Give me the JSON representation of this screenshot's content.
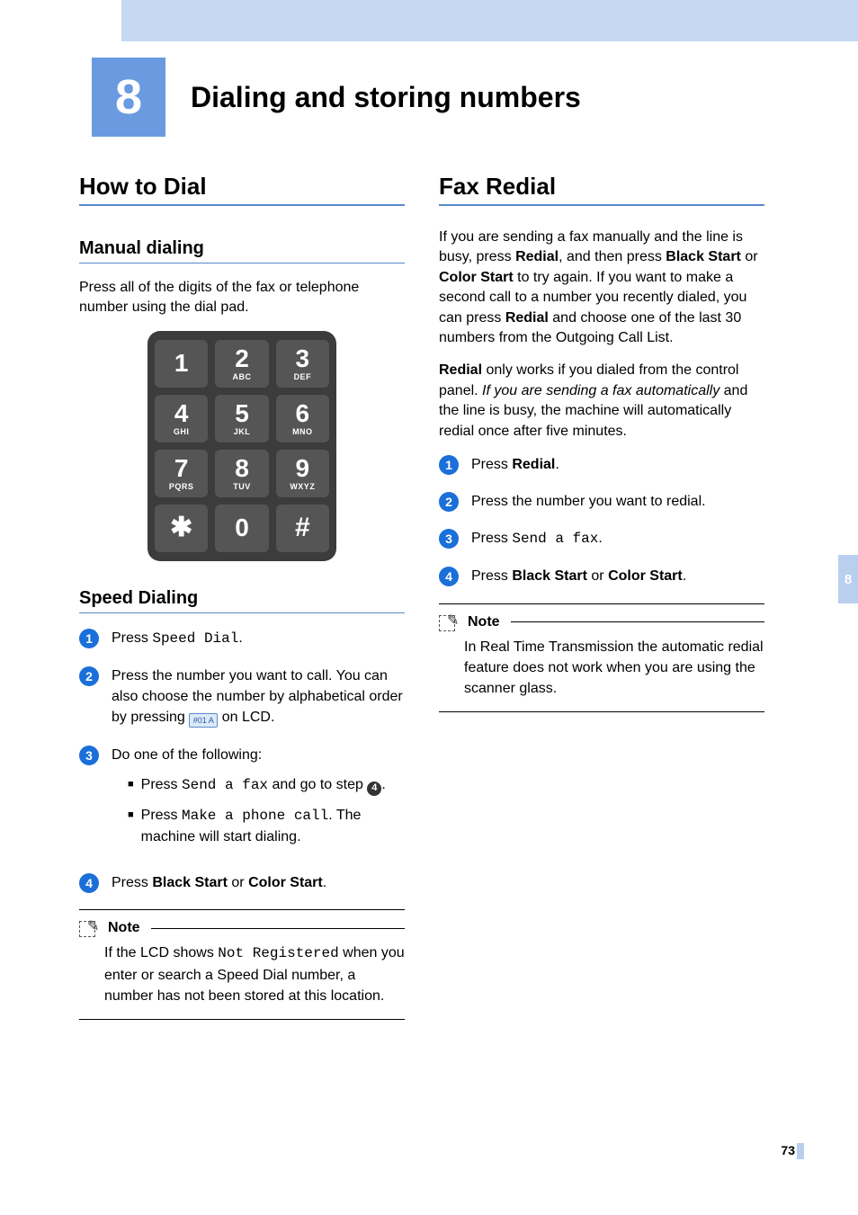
{
  "chapter": {
    "number": "8",
    "title": "Dialing and storing numbers"
  },
  "sideTab": "8",
  "pageNumber": "73",
  "left": {
    "h1": "How to Dial",
    "manual": {
      "heading": "Manual dialing",
      "text": "Press all of the digits of the fax or telephone number using the dial pad."
    },
    "dialpad": [
      {
        "n": "1",
        "l": ""
      },
      {
        "n": "2",
        "l": "ABC"
      },
      {
        "n": "3",
        "l": "DEF"
      },
      {
        "n": "4",
        "l": "GHI"
      },
      {
        "n": "5",
        "l": "JKL"
      },
      {
        "n": "6",
        "l": "MNO"
      },
      {
        "n": "7",
        "l": "PQRS"
      },
      {
        "n": "8",
        "l": "TUV"
      },
      {
        "n": "9",
        "l": "WXYZ"
      },
      {
        "n": "✱",
        "l": ""
      },
      {
        "n": "0",
        "l": ""
      },
      {
        "n": "#",
        "l": ""
      }
    ],
    "speed": {
      "heading": "Speed Dialing",
      "s1_a": "Press ",
      "s1_code": "Speed Dial",
      "s1_b": ".",
      "s2_a": "Press the number you want to call. You can also choose the number by alphabetical order by pressing ",
      "s2_b": " on LCD.",
      "s3": "Do one of the following:",
      "s3_b1_a": "Press ",
      "s3_b1_code": "Send a fax",
      "s3_b1_b": " and go to step ",
      "s3_b1_badge": "4",
      "s3_b1_c": ".",
      "s3_b2_a": "Press ",
      "s3_b2_code": "Make a phone call",
      "s3_b2_b": ". The machine will start dialing.",
      "s4_a": "Press ",
      "s4_b1": "Black Start",
      "s4_or": " or ",
      "s4_b2": "Color Start",
      "s4_c": ".",
      "note": {
        "label": "Note",
        "text_a": "If the LCD shows ",
        "text_code": "Not Registered",
        "text_b": " when you enter or search a Speed Dial number, a number has not been stored at this location."
      }
    }
  },
  "right": {
    "h1": "Fax Redial",
    "p1_a": "If you are sending a fax manually and the line is busy, press ",
    "p1_b": "Redial",
    "p1_c": ", and then press ",
    "p1_d": "Black Start",
    "p1_e": " or ",
    "p1_f": "Color Start",
    "p1_g": " to try again. If you want to make a second call to a number you recently dialed, you can press ",
    "p1_h": "Redial",
    "p1_i": " and choose one of the last 30 numbers from the Outgoing Call List.",
    "p2_a": "Redial",
    "p2_b": " only works if you dialed from the control panel. ",
    "p2_c": "If you are sending a fax automatically",
    "p2_d": " and the line is busy, the machine will automatically redial once after five minutes.",
    "s1_a": "Press ",
    "s1_b": "Redial",
    "s1_c": ".",
    "s2": "Press the number you want to redial.",
    "s3_a": "Press ",
    "s3_code": "Send a fax",
    "s3_b": ".",
    "s4_a": "Press ",
    "s4_b": "Black Start",
    "s4_or": " or ",
    "s4_c": "Color Start",
    "s4_d": ".",
    "note": {
      "label": "Note",
      "text": "In Real Time Transmission the automatic redial feature does not work when you are using the scanner glass."
    }
  }
}
